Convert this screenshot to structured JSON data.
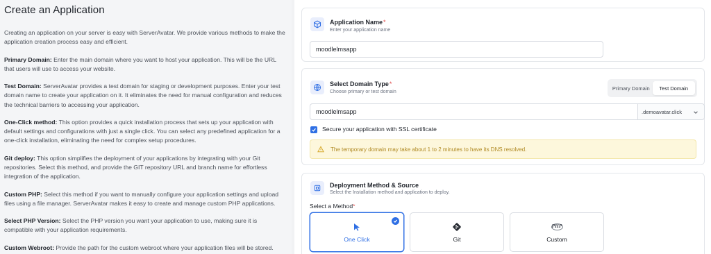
{
  "left": {
    "title": "Create an Application",
    "intro": "Creating an application on your server is easy with ServerAvatar. We provide various methods to make the application creation process easy and efficient.",
    "sections": [
      {
        "term": "Primary Domain:",
        "text": " Enter the main domain where you want to host your application. This will be the URL that users will use to access your website."
      },
      {
        "term": "Test Domain:",
        "text": " ServerAvatar provides a test domain for staging or development purposes. Enter your test domain name to create your application on it. It eliminates the need for manual configuration and reduces the technical barriers to accessing your application."
      },
      {
        "term": "One-Click method:",
        "text": " This option provides a quick installation process that sets up your application with default settings and configurations with just a single click. You can select any predefined application for a one-click installation, eliminating the need for complex setup procedures."
      },
      {
        "term": "Git deploy:",
        "text": " This option simplifies the deployment of your applications by integrating with your Git repositories. Select this method, and provide the GIT repository URL and branch name for effortless integration of the application."
      },
      {
        "term": "Custom PHP:",
        "text": " Select this method if you want to manually configure your application settings and upload files using a file manager. ServerAvatar makes it easy to create and manage custom PHP applications."
      },
      {
        "term": "Select PHP Version:",
        "text": " Select the PHP version you want your application to use, making sure it is compatible with your application requirements."
      },
      {
        "term": "Custom Webroot:",
        "text": " Provide the path for the custom webroot where your application files will be stored."
      }
    ]
  },
  "app_name": {
    "title": "Application Name",
    "required_mark": "*",
    "subtitle": "Enter your application name",
    "value": "moodlelmsapp"
  },
  "domain": {
    "title": "Select Domain Type",
    "required_mark": "*",
    "subtitle": "Choose primary or test domain",
    "toggle_primary": "Primary Domain",
    "toggle_test": "Test Domain",
    "selected": "Test Domain",
    "value": "moodlelmsapp",
    "suffix": ".demoavatar.click",
    "ssl_label": "Secure your application with SSL certificate",
    "ssl_checked": true,
    "alert": "The temporary domain may take about 1 to 2 minutes to have its DNS resolved."
  },
  "deploy": {
    "title": "Deployment Method & Source",
    "subtitle": "Select the Installation method and application to deploy.",
    "method_label": "Select a Method",
    "required_mark": "*",
    "methods": [
      {
        "label": "One Click",
        "icon": "cursor-icon",
        "selected": true
      },
      {
        "label": "Git",
        "icon": "git-icon",
        "selected": false
      },
      {
        "label": "Custom",
        "icon": "php-icon",
        "selected": false
      }
    ],
    "php_logo_text": "PHP"
  },
  "colors": {
    "accent": "#2f6fe4",
    "alert_bg": "#fdf7dc",
    "alert_text": "#b08a24",
    "required": "#e04848"
  }
}
